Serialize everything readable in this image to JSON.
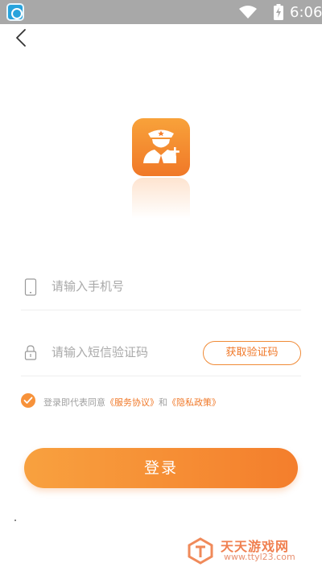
{
  "status_bar": {
    "time": "6:06",
    "app_icon": "app-notification-icon",
    "wifi_icon": "wifi-icon",
    "battery_icon": "battery-charging-icon"
  },
  "header": {
    "back_icon": "chevron-left-icon"
  },
  "logo": {
    "icon": "police-officer-add-icon",
    "accent": "#f47e2c"
  },
  "form": {
    "phone": {
      "placeholder": "请输入手机号",
      "value": "",
      "icon": "phone-icon"
    },
    "code": {
      "placeholder": "请输入短信验证码",
      "value": "",
      "icon": "lock-icon"
    },
    "get_code_label": "获取验证码"
  },
  "agreement": {
    "checked": true,
    "prefix": "登录即代表同意",
    "terms_link": "《服务协议》",
    "and": "和",
    "privacy_link": "《隐私政策》"
  },
  "login_label": "登录",
  "watermark": {
    "title": "天天游戏网",
    "url": "www.ttyl23.com"
  },
  "colors": {
    "primary": "#f47e2c",
    "primary_light": "#f8a13f",
    "placeholder": "#a9a9a9"
  }
}
